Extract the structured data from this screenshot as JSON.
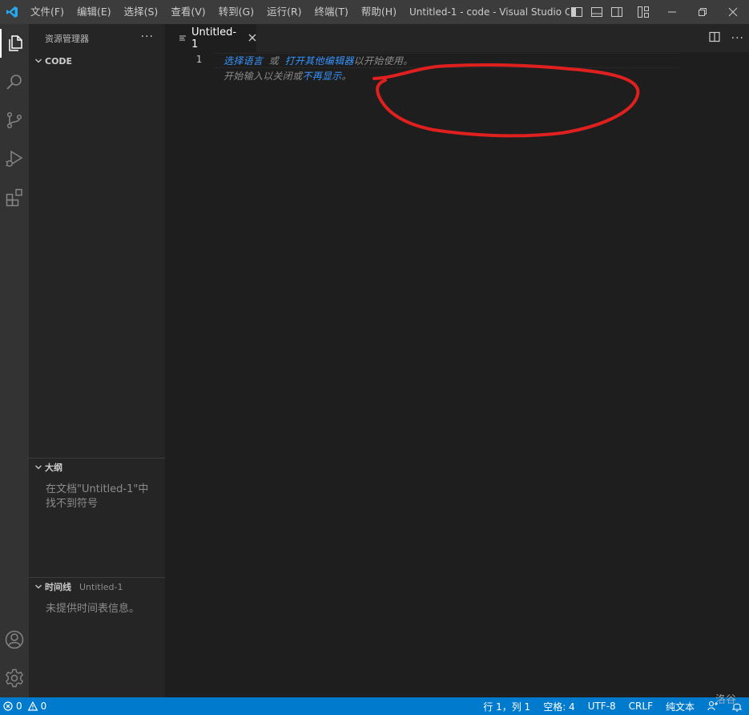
{
  "titlebar": {
    "menus": [
      "文件(F)",
      "编辑(E)",
      "选择(S)",
      "查看(V)",
      "转到(G)",
      "运行(R)",
      "终端(T)",
      "帮助(H)"
    ],
    "window_title": "Untitled-1 - code - Visual Studio Co..."
  },
  "activitybar": {
    "icons": [
      "explorer-icon",
      "search-icon",
      "source-control-icon",
      "run-debug-icon",
      "extensions-icon",
      "account-icon",
      "settings-gear-icon"
    ]
  },
  "sidebar": {
    "title": "资源管理器",
    "more": "···",
    "folder": "CODE",
    "outline": {
      "title": "大纲",
      "message": "在文档\"Untitled-1\"中找不到符号"
    },
    "timeline": {
      "title": "时间线",
      "file": "Untitled-1",
      "message": "未提供时间表信息。"
    }
  },
  "editor": {
    "tab_label": "Untitled-1",
    "line_number": "1",
    "hint_line1": {
      "link1": "选择语言",
      "sep": " 或 ",
      "link2": "打开其他编辑器",
      "tail": "以开始使用。"
    },
    "hint_line2": {
      "head": "开始输入以关闭或",
      "link": "不再显示",
      "tail": "。"
    },
    "more": "···"
  },
  "statusbar": {
    "errors": "0",
    "warnings": "0",
    "position": "行 1，列 1",
    "spaces": "空格: 4",
    "encoding": "UTF-8",
    "eol": "CRLF",
    "language": "纯文本"
  },
  "watermark": "洛谷",
  "colors": {
    "accent": "#007acc",
    "link": "#3794ff",
    "annotation": "#e0201f"
  }
}
